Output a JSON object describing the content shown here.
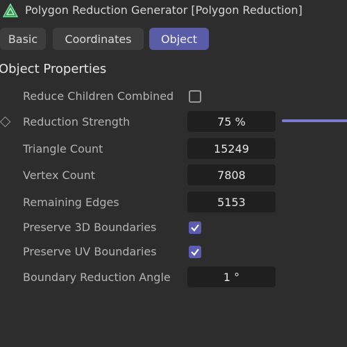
{
  "window": {
    "title": "Polygon Reduction Generator [Polygon Reduction]",
    "icon": "polygon-reduction-triangle-icon"
  },
  "tabs": [
    {
      "label": "Basic",
      "active": false
    },
    {
      "label": "Coordinates",
      "active": false
    },
    {
      "label": "Object",
      "active": true
    }
  ],
  "section": {
    "title": "Object Properties"
  },
  "properties": {
    "reduce_children_combined": {
      "label": "Reduce Children Combined",
      "checked": false
    },
    "reduction_strength": {
      "label": "Reduction Strength",
      "value": "75 %",
      "slider_fraction": 0.75
    },
    "triangle_count": {
      "label": "Triangle Count",
      "value": "15249"
    },
    "vertex_count": {
      "label": "Vertex Count",
      "value": "7808"
    },
    "remaining_edges": {
      "label": "Remaining Edges",
      "value": "5153"
    },
    "preserve_3d_boundaries": {
      "label": "Preserve 3D Boundaries",
      "checked": true
    },
    "preserve_uv_boundaries": {
      "label": "Preserve UV Boundaries",
      "checked": true
    },
    "boundary_reduction_angle": {
      "label": "Boundary Reduction Angle",
      "value": "1 °"
    }
  },
  "colors": {
    "background": "#2d2d2d",
    "accent": "#5a5ca8",
    "field_background": "#1f1f1f",
    "tab_background": "#3d3d3d"
  }
}
